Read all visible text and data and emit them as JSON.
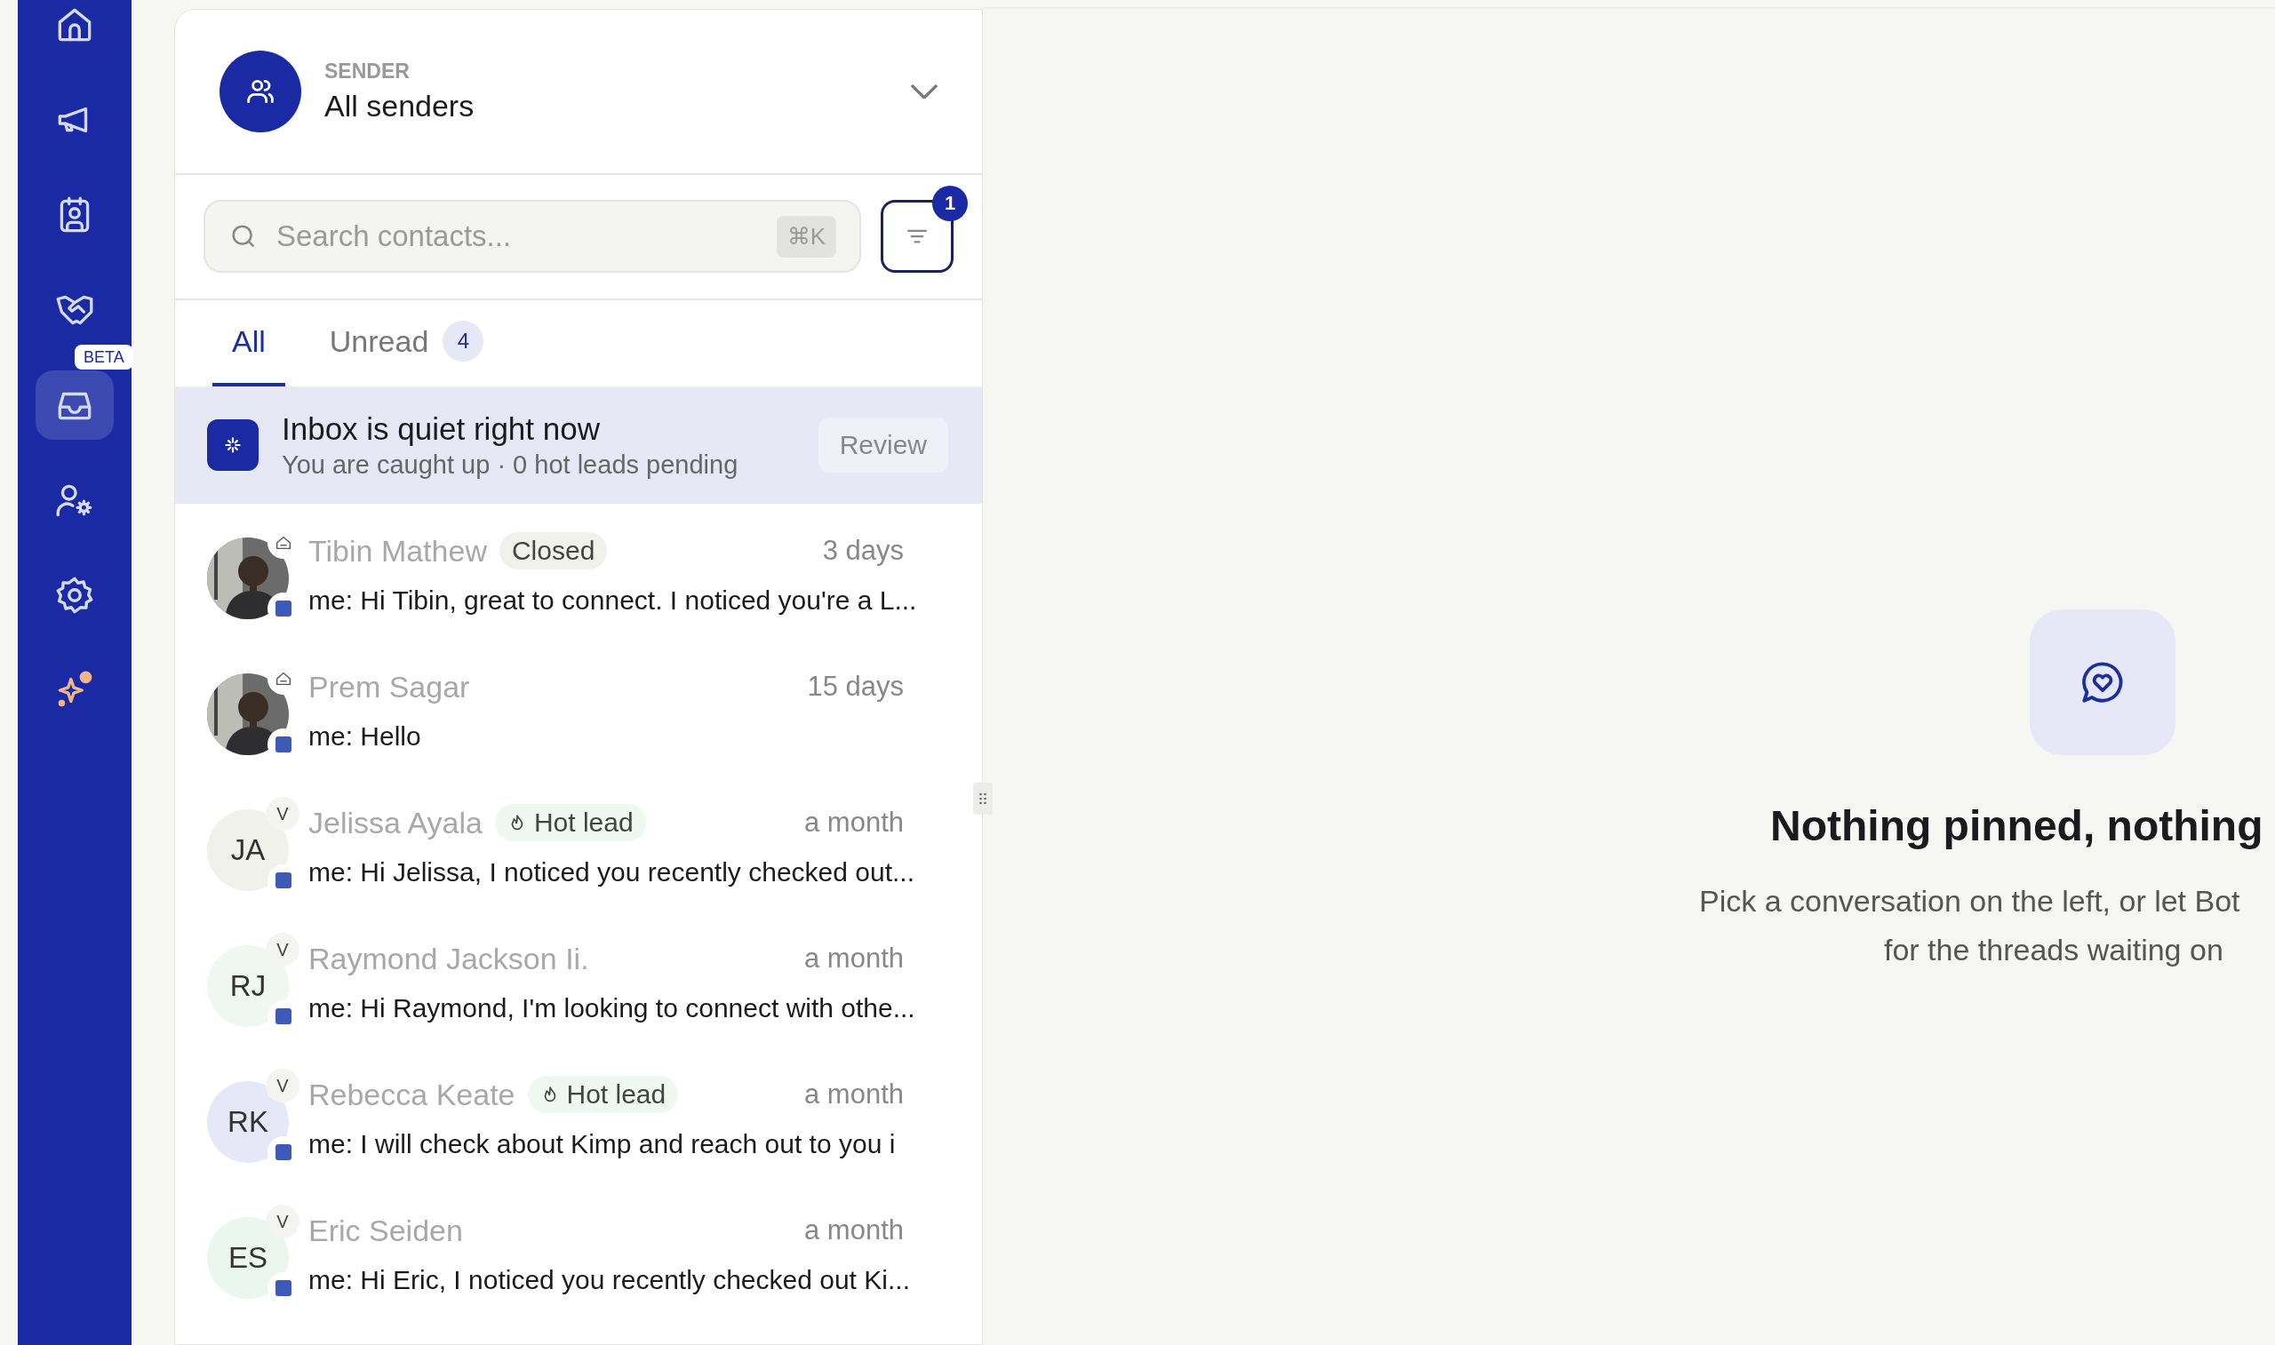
{
  "nav": {
    "items": [
      {
        "selected": false
      },
      {
        "selected": false
      },
      {
        "selected": false
      },
      {
        "selected": false
      },
      {
        "selected": true,
        "badge": "BETA"
      },
      {
        "selected": false
      },
      {
        "selected": false
      },
      {
        "selected": false
      }
    ]
  },
  "sender": {
    "label": "SENDER",
    "value": "All senders"
  },
  "search": {
    "placeholder": "Search contacts...",
    "shortcut": "⌘K"
  },
  "filter": {
    "count": "1"
  },
  "tabs": [
    {
      "label": "All",
      "selected": true
    },
    {
      "label": "Unread",
      "count": "4",
      "selected": false
    }
  ],
  "banner": {
    "title": "Inbox is quiet right now",
    "subtitle": "You are caught up · 0 hot leads pending",
    "action": "Review"
  },
  "conversations": [
    {
      "name": "Tibin Mathew",
      "tag": {
        "kind": "closed",
        "label": "Closed"
      },
      "time": "3 days",
      "preview": "me: Hi Tibin, great to connect. I noticed you're a L..."
    },
    {
      "name": "Prem Sagar",
      "time": "15 days",
      "preview": "me: Hello"
    },
    {
      "name": "Jelissa Ayala",
      "tag": {
        "kind": "hot",
        "label": "Hot lead"
      },
      "time": "a month",
      "preview": "me: Hi Jelissa, I noticed you recently checked out...",
      "avatar": {
        "kind": "initials",
        "initials": "JA",
        "badge": "V",
        "color": "#f1f1ec"
      }
    },
    {
      "name": "Raymond Jackson Ii.",
      "time": "a month",
      "preview": "me: Hi Raymond, I'm looking to connect with othe...",
      "avatar": {
        "kind": "initials",
        "initials": "RJ",
        "badge": "V",
        "color": "#eef7f0"
      }
    },
    {
      "name": "Rebecca Keate",
      "tag": {
        "kind": "hot",
        "label": "Hot lead"
      },
      "time": "a month",
      "preview": "me: I will check about Kimp and reach out to you i",
      "avatar": {
        "kind": "initials",
        "initials": "RK",
        "badge": "V",
        "color": "#e6e8f8"
      }
    },
    {
      "name": "Eric Seiden",
      "time": "a month",
      "preview": "me: Hi Eric, I noticed you recently checked out Ki...",
      "avatar": {
        "kind": "initials",
        "initials": "ES",
        "badge": "V",
        "color": "#eaf6ee"
      }
    }
  ],
  "empty_state": {
    "title": "Nothing pinned, nothing",
    "lines": [
      "Pick a conversation on the left, or let Bot",
      "for the threads waiting on"
    ]
  }
}
